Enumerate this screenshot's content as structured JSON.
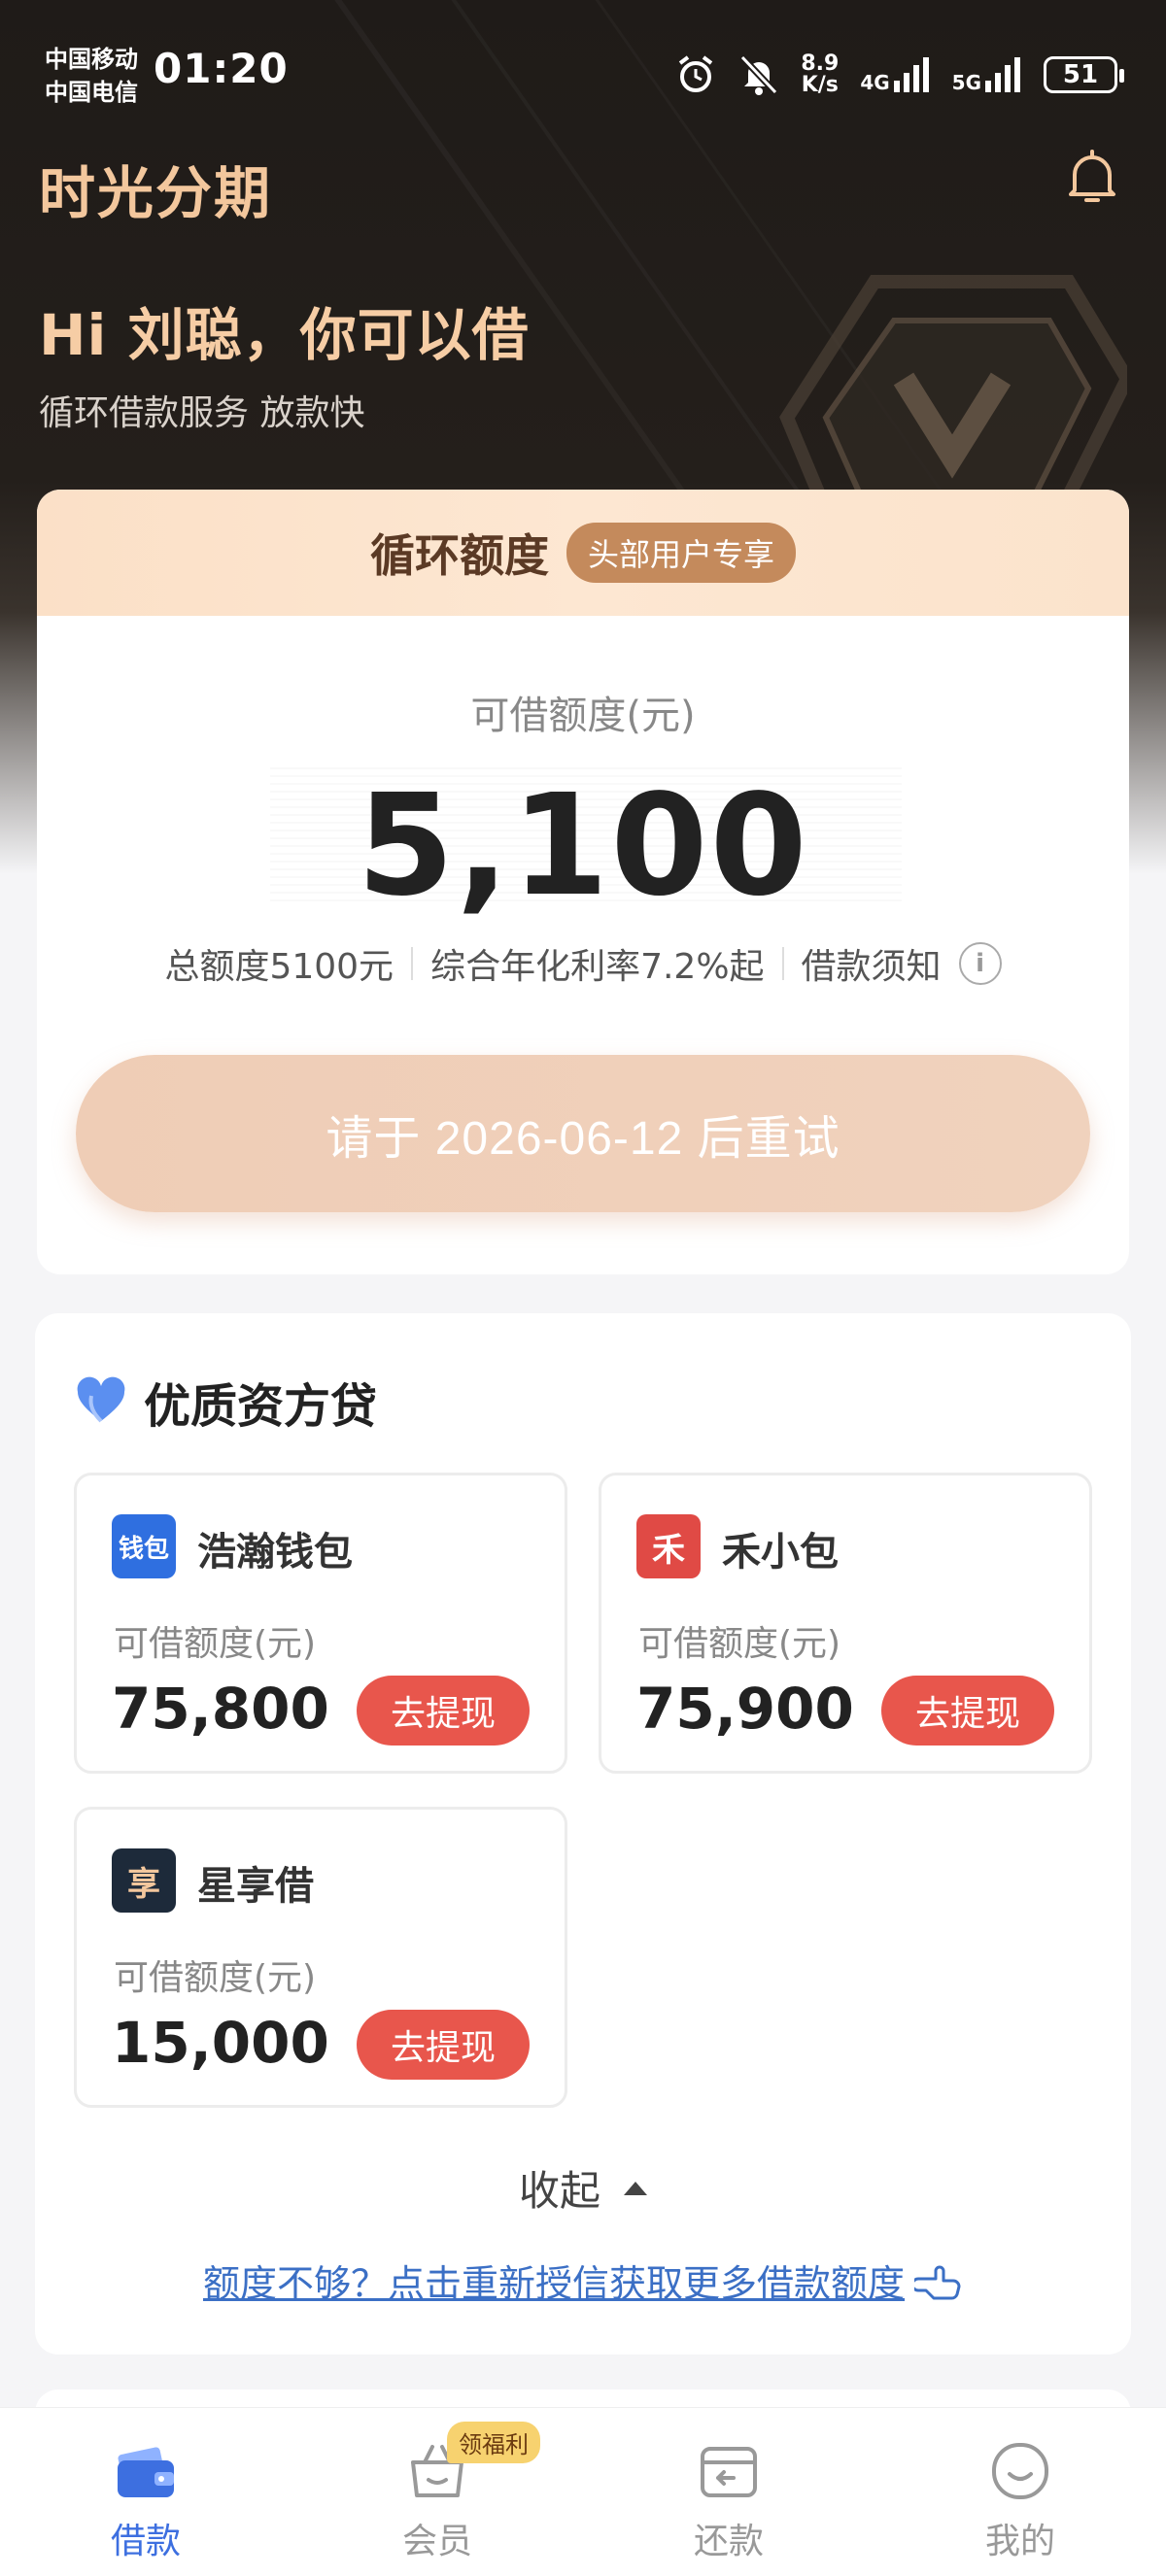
{
  "status_bar": {
    "carrier1": "中国移动",
    "carrier2": "中国电信",
    "time": "01:20",
    "net_speed_value": "8.9",
    "net_speed_unit": "K/s",
    "signal1_label": "4G",
    "signal2_label": "5G",
    "battery": "51"
  },
  "header": {
    "app_title": "时光分期",
    "greeting": "Hi 刘聪，你可以借",
    "subtitle": "循环借款服务 放款快"
  },
  "credit_card": {
    "title": "循环额度",
    "tag": "头部用户专享",
    "available_label": "可借额度(元)",
    "available_amount": "5,100",
    "total_limit": "总额度5100元",
    "annual_rate": "综合年化利率7.2%起",
    "loan_notice": "借款须知",
    "retry_button": "请于 2026-06-12 后重试"
  },
  "lenders": {
    "section_title": "优质资方贷",
    "items": [
      {
        "name": "浩瀚钱包",
        "label": "可借额度(元)",
        "amount": "75,800",
        "button": "去提现",
        "logo_text": "钱包",
        "logo_color": "#2f6fe0"
      },
      {
        "name": "禾小包",
        "label": "可借额度(元)",
        "amount": "75,900",
        "button": "去提现",
        "logo_text": "禾",
        "logo_color": "#e04a45"
      },
      {
        "name": "星享借",
        "label": "可借额度(元)",
        "amount": "15,000",
        "button": "去提现",
        "logo_text": "享",
        "logo_color": "#1d2a3a"
      }
    ],
    "collapse": "收起",
    "reauth_link": "额度不够？点击重新授信获取更多借款额度"
  },
  "bottom_nav": {
    "items": [
      {
        "label": "借款",
        "active": true
      },
      {
        "label": "会员",
        "badge": "领福利"
      },
      {
        "label": "还款"
      },
      {
        "label": "我的"
      }
    ]
  },
  "colors": {
    "accent_gold": "#f3c79d",
    "withdraw_red": "#e8564c",
    "nav_active": "#3d6fe0",
    "link_blue": "#3b6fc5"
  }
}
